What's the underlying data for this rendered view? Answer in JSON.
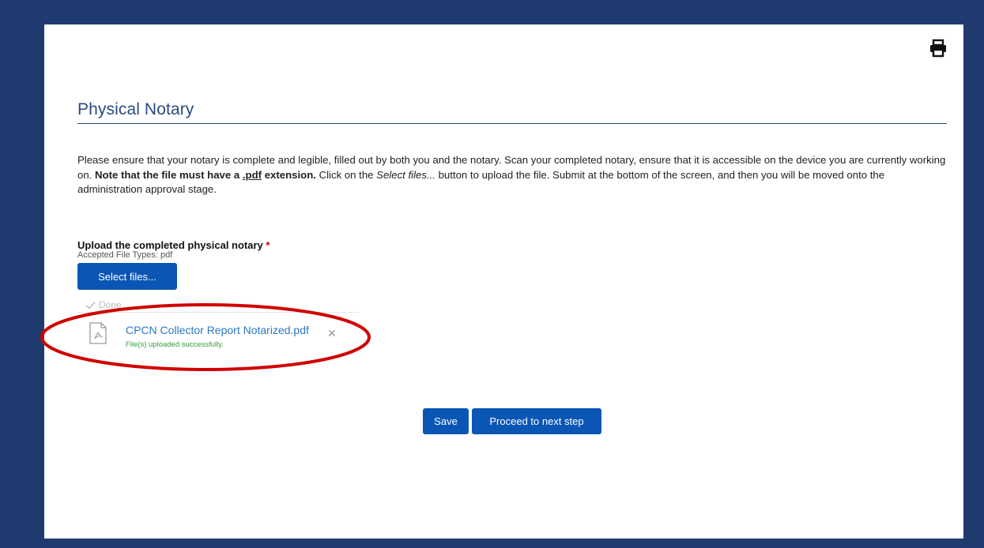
{
  "page": {
    "title": "Physical Notary",
    "instructions": {
      "part1": "Please ensure that your notary is complete and legible, filled out by both you and the notary. Scan your completed notary, ensure that it is accessible on the device you are currently working on. ",
      "bold_a": "Note that the file must have a ",
      "bold_ext": ".pdf",
      "bold_b": " extension.",
      "part2": " Click on the ",
      "italic": "Select files...",
      "part3": " button to upload the file. Submit at the bottom of the screen, and then you will be moved onto the administration approval stage."
    }
  },
  "upload": {
    "label": "Upload the completed physical notary ",
    "required_mark": "*",
    "accepted_types": "Accepted File Types: pdf",
    "select_button": "Select files...",
    "done_label": "Done",
    "file": {
      "name": "CPCN Collector Report Notarized.pdf",
      "status": "File(s) uploaded successfully."
    }
  },
  "actions": {
    "save": "Save",
    "next": "Proceed to next step"
  },
  "icons": {
    "print": "print-icon",
    "file": "pdf-file-icon",
    "remove": "close-icon",
    "done": "check-icon"
  },
  "colors": {
    "frame": "#1f3a6e",
    "primary_button": "#0b56b4",
    "title": "#2b4a7f",
    "link": "#2a78c2",
    "success": "#3a9a3a",
    "highlight_ellipse": "#d00000"
  }
}
